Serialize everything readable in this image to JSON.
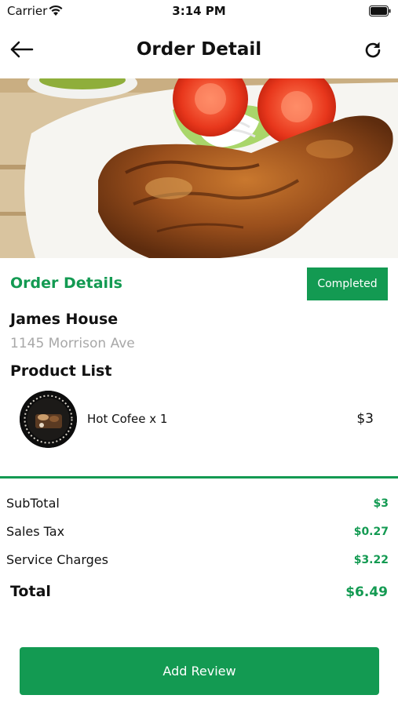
{
  "status_bar": {
    "carrier": "Carrier",
    "time": "3:14 PM",
    "icons": [
      "wifi-icon",
      "battery-icon"
    ]
  },
  "nav": {
    "title": "Order Detail",
    "back_icon": "back-arrow-icon",
    "refresh_icon": "refresh-icon"
  },
  "hero": {
    "image": "grilled chicken leg with tomato slices and onions"
  },
  "order": {
    "section_title": "Order Details",
    "status": "Completed",
    "customer_name": "James House",
    "address": "1145 Morrison Ave",
    "product_list_title": "Product List",
    "products": [
      {
        "name": "Hot Cofee x 1",
        "price": "$3"
      }
    ]
  },
  "summary": {
    "subtotal_label": "SubTotal",
    "subtotal_value": "$3",
    "tax_label": "Sales Tax",
    "tax_value": "$0.27",
    "service_label": "Service Charges",
    "service_value": "$3.22",
    "total_label": "Total",
    "total_value": "$6.49"
  },
  "actions": {
    "review_button": "Add Review"
  },
  "colors": {
    "accent": "#139a52",
    "muted_text": "#a8a8a8"
  }
}
